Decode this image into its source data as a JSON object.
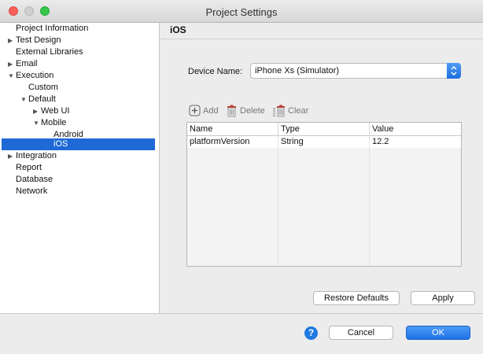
{
  "window": {
    "title": "Project Settings"
  },
  "sidebar": {
    "items": [
      {
        "label": "Project Information",
        "arrow": ""
      },
      {
        "label": "Test Design",
        "arrow": "▶"
      },
      {
        "label": "External Libraries",
        "arrow": ""
      },
      {
        "label": "Email",
        "arrow": "▶"
      },
      {
        "label": "Execution",
        "arrow": "▼"
      },
      {
        "label": "Custom",
        "arrow": ""
      },
      {
        "label": "Default",
        "arrow": "▼"
      },
      {
        "label": "Web UI",
        "arrow": "▶"
      },
      {
        "label": "Mobile",
        "arrow": "▼"
      },
      {
        "label": "Android",
        "arrow": ""
      },
      {
        "label": "iOS",
        "arrow": ""
      },
      {
        "label": "Integration",
        "arrow": "▶"
      },
      {
        "label": "Report",
        "arrow": ""
      },
      {
        "label": "Database",
        "arrow": ""
      },
      {
        "label": "Network",
        "arrow": ""
      }
    ]
  },
  "panel": {
    "title": "iOS",
    "device_label": "Device Name:",
    "device_value": "iPhone Xs (Simulator)",
    "toolbar": {
      "add": "Add",
      "delete": "Delete",
      "clear": "Clear"
    },
    "table": {
      "headers": [
        "Name",
        "Type",
        "Value"
      ],
      "rows": [
        [
          "platformVersion",
          "String",
          "12.2"
        ]
      ]
    }
  },
  "buttons": {
    "restore_defaults": "Restore Defaults",
    "apply": "Apply",
    "cancel": "Cancel",
    "ok": "OK",
    "help": "?"
  }
}
